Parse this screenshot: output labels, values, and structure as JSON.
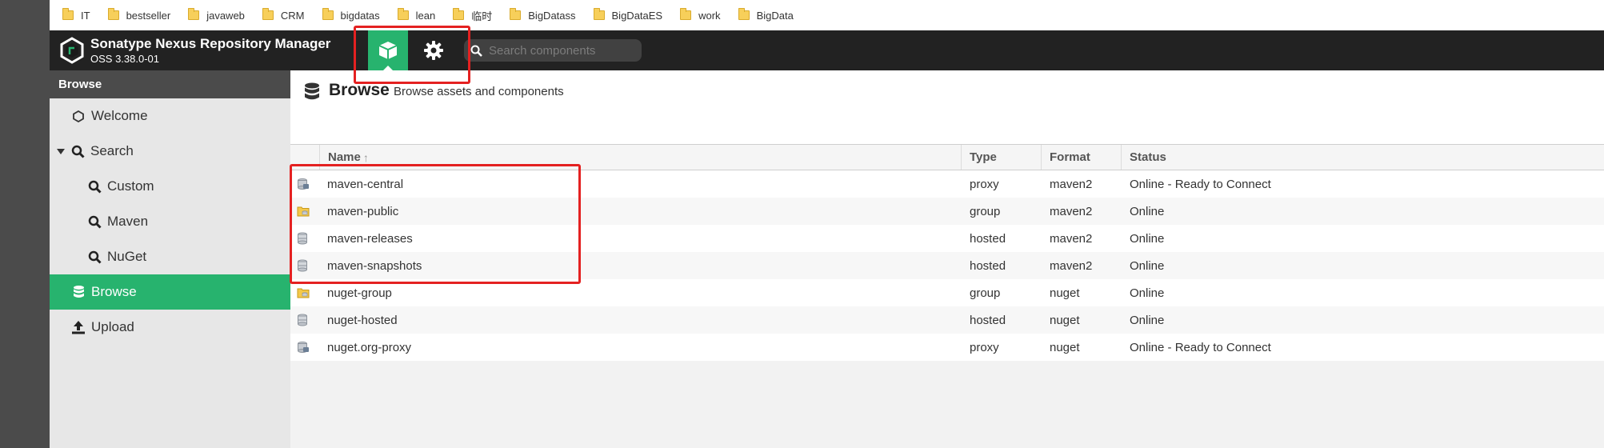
{
  "bookmarks": [
    "IT",
    "bestseller",
    "javaweb",
    "CRM",
    "bigdatas",
    "lean",
    "临时",
    "BigDatass",
    "BigDataES",
    "work",
    "BigData"
  ],
  "app": {
    "title": "Sonatype Nexus Repository Manager",
    "version": "OSS 3.38.0-01"
  },
  "search": {
    "placeholder": "Search components"
  },
  "colors": {
    "accent": "#27b36e",
    "topbar": "#222222",
    "highlight": "#e42121"
  },
  "sidebar": {
    "header": "Browse",
    "items": [
      {
        "label": "Welcome",
        "icon": "hexagon-icon"
      },
      {
        "label": "Search",
        "icon": "search-icon",
        "expanded": true
      },
      {
        "label": "Custom",
        "icon": "search-icon"
      },
      {
        "label": "Maven",
        "icon": "search-icon"
      },
      {
        "label": "NuGet",
        "icon": "search-icon"
      },
      {
        "label": "Browse",
        "icon": "database-icon",
        "active": true
      },
      {
        "label": "Upload",
        "icon": "upload-icon"
      }
    ]
  },
  "main": {
    "title": "Browse",
    "subtitle": "Browse assets and components"
  },
  "table": {
    "columns": {
      "name": "Name",
      "sort": "↑",
      "type": "Type",
      "format": "Format",
      "status": "Status"
    },
    "rows": [
      {
        "icon": "proxy-repo-icon",
        "name": "maven-central",
        "type": "proxy",
        "format": "maven2",
        "status": "Online - Ready to Connect"
      },
      {
        "icon": "group-repo-icon",
        "name": "maven-public",
        "type": "group",
        "format": "maven2",
        "status": "Online"
      },
      {
        "icon": "hosted-repo-icon",
        "name": "maven-releases",
        "type": "hosted",
        "format": "maven2",
        "status": "Online"
      },
      {
        "icon": "hosted-repo-icon",
        "name": "maven-snapshots",
        "type": "hosted",
        "format": "maven2",
        "status": "Online"
      },
      {
        "icon": "group-repo-icon",
        "name": "nuget-group",
        "type": "group",
        "format": "nuget",
        "status": "Online"
      },
      {
        "icon": "hosted-repo-icon",
        "name": "nuget-hosted",
        "type": "hosted",
        "format": "nuget",
        "status": "Online"
      },
      {
        "icon": "proxy-repo-icon",
        "name": "nuget.org-proxy",
        "type": "proxy",
        "format": "nuget",
        "status": "Online - Ready to Connect"
      }
    ]
  }
}
